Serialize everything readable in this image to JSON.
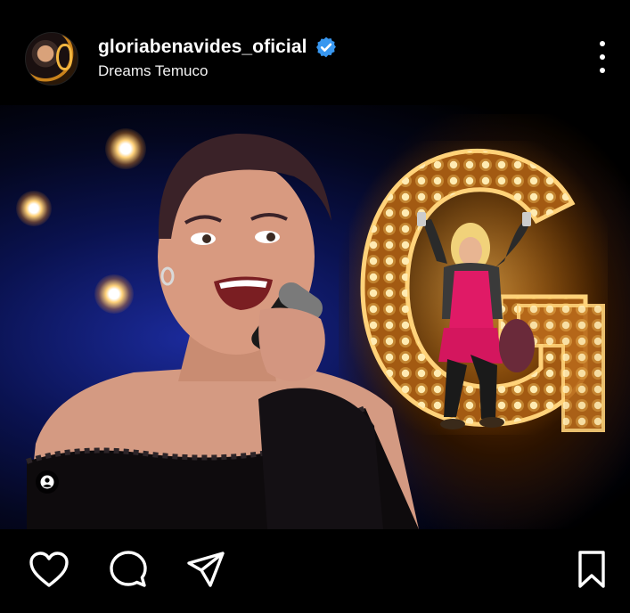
{
  "post": {
    "username": "gloriabenavides_oficial",
    "location": "Dreams Temuco",
    "verified": true
  },
  "icons": {
    "more": "more-vertical-icon",
    "like": "heart-icon",
    "comment": "comment-bubble-icon",
    "share": "paper-plane-icon",
    "save": "bookmark-icon",
    "tag": "user-tag-icon"
  },
  "colors": {
    "background": "#000000",
    "verified_badge": "#3897f0",
    "text": "#ffffff"
  }
}
